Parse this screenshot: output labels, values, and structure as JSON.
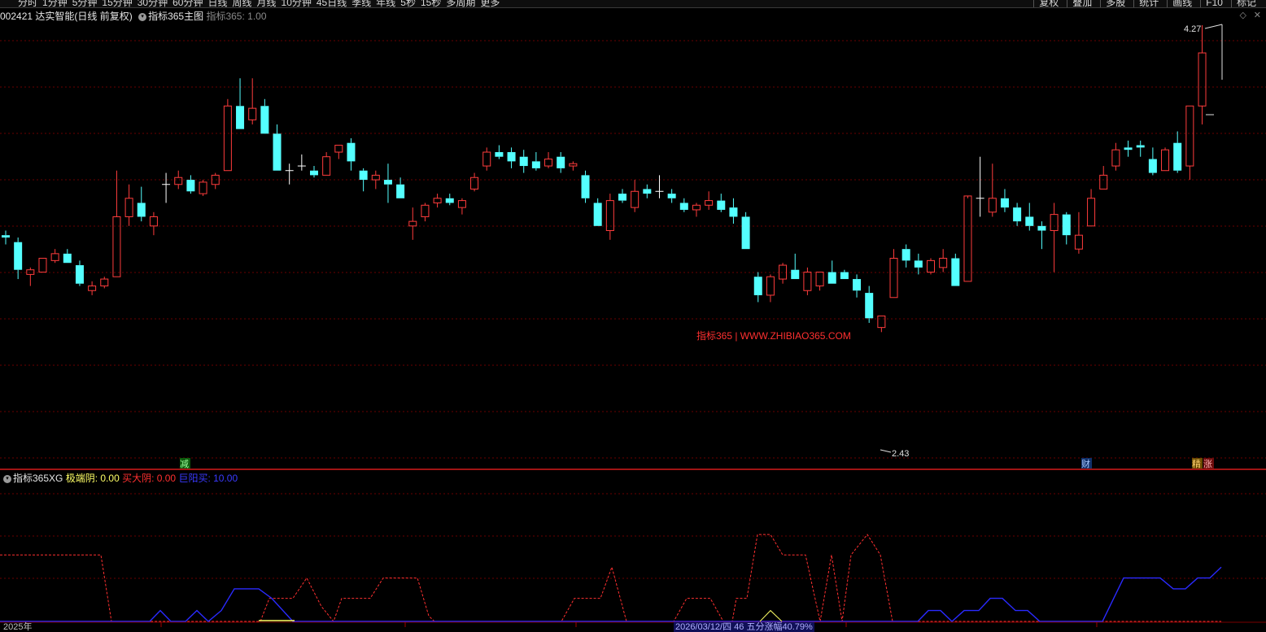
{
  "toolbar": {
    "periods": [
      "分时",
      "1分钟",
      "5分钟",
      "15分钟",
      "30分钟",
      "60分钟",
      "日线",
      "周线",
      "月线",
      "10分钟",
      "45日线",
      "季线",
      "年线",
      "5秒",
      "15秒",
      "多周期",
      "更多"
    ],
    "right_items": [
      "复权",
      "叠加",
      "多股",
      "统计",
      "画线",
      "F10",
      "标记"
    ]
  },
  "stock_header": {
    "code": "002421",
    "name": "达实智能",
    "mode": "(日线 前复权)",
    "indicator_name": "指标365主图",
    "indicator_value_label": "指标365: 1.00"
  },
  "indicator_header": {
    "name": "指标365XG",
    "items": [
      {
        "label": "极端阴: 0.00",
        "color": "#ffff66"
      },
      {
        "label": "买大阴: 0.00",
        "color": "#ff3030"
      },
      {
        "label": "巨阳买: 10.00",
        "color": "#3a3aff"
      }
    ]
  },
  "watermark": "指标365 | WWW.ZHIBIAO365.COM",
  "markers": {
    "high_price": "4.27",
    "low_price": "2.43",
    "event_left": "减",
    "event_cai": "财",
    "event_jing": "精",
    "event_zhang": "涨"
  },
  "bottom": {
    "year": "2025年",
    "date_info": "2026/03/12/四 46 五分涨幅40.79%"
  },
  "colors": {
    "up": "#ff3c3c",
    "down": "#54ffff",
    "doji": "#ffffff",
    "grid": "#6a0000",
    "divider": "#ff2020",
    "line_red": "#ff3030",
    "line_blue": "#2a2aff",
    "line_yellow": "#ffff66"
  },
  "chart_data": {
    "type": "candlestick",
    "price_range": [
      2.43,
      4.27
    ],
    "candles": [
      [
        3.36,
        3.38,
        3.32,
        3.35
      ],
      [
        3.33,
        3.35,
        3.17,
        3.21
      ],
      [
        3.19,
        3.22,
        3.14,
        3.21
      ],
      [
        3.2,
        3.26,
        3.2,
        3.26
      ],
      [
        3.25,
        3.3,
        3.24,
        3.28
      ],
      [
        3.28,
        3.3,
        3.24,
        3.24
      ],
      [
        3.23,
        3.25,
        3.14,
        3.15
      ],
      [
        3.12,
        3.16,
        3.1,
        3.14
      ],
      [
        3.14,
        3.18,
        3.13,
        3.17
      ],
      [
        3.18,
        3.64,
        3.18,
        3.44
      ],
      [
        3.44,
        3.58,
        3.4,
        3.52
      ],
      [
        3.5,
        3.57,
        3.42,
        3.44
      ],
      [
        3.4,
        3.46,
        3.36,
        3.44
      ],
      [
        3.58,
        3.63,
        3.5,
        3.58
      ],
      [
        3.58,
        3.64,
        3.56,
        3.61
      ],
      [
        3.6,
        3.62,
        3.54,
        3.55
      ],
      [
        3.54,
        3.6,
        3.53,
        3.59
      ],
      [
        3.58,
        3.63,
        3.56,
        3.62
      ],
      [
        3.64,
        3.95,
        3.64,
        3.92
      ],
      [
        3.92,
        4.04,
        3.82,
        3.82
      ],
      [
        3.86,
        4.04,
        3.84,
        3.91
      ],
      [
        3.92,
        3.95,
        3.8,
        3.8
      ],
      [
        3.8,
        3.84,
        3.64,
        3.64
      ],
      [
        3.64,
        3.67,
        3.58,
        3.64
      ],
      [
        3.66,
        3.71,
        3.64,
        3.66
      ],
      [
        3.64,
        3.66,
        3.61,
        3.62
      ],
      [
        3.62,
        3.72,
        3.62,
        3.7
      ],
      [
        3.72,
        3.75,
        3.69,
        3.75
      ],
      [
        3.76,
        3.78,
        3.64,
        3.68
      ],
      [
        3.64,
        3.65,
        3.55,
        3.6
      ],
      [
        3.6,
        3.64,
        3.56,
        3.62
      ],
      [
        3.6,
        3.67,
        3.5,
        3.58
      ],
      [
        3.58,
        3.61,
        3.52,
        3.52
      ],
      [
        3.4,
        3.48,
        3.34,
        3.42
      ],
      [
        3.44,
        3.5,
        3.42,
        3.49
      ],
      [
        3.5,
        3.54,
        3.48,
        3.52
      ],
      [
        3.52,
        3.54,
        3.49,
        3.5
      ],
      [
        3.48,
        3.52,
        3.45,
        3.51
      ],
      [
        3.56,
        3.63,
        3.55,
        3.61
      ],
      [
        3.66,
        3.74,
        3.64,
        3.72
      ],
      [
        3.72,
        3.75,
        3.69,
        3.7
      ],
      [
        3.72,
        3.74,
        3.65,
        3.68
      ],
      [
        3.7,
        3.73,
        3.63,
        3.66
      ],
      [
        3.68,
        3.72,
        3.64,
        3.65
      ],
      [
        3.66,
        3.72,
        3.65,
        3.69
      ],
      [
        3.7,
        3.72,
        3.63,
        3.65
      ],
      [
        3.66,
        3.68,
        3.64,
        3.67
      ],
      [
        3.62,
        3.64,
        3.5,
        3.52
      ],
      [
        3.5,
        3.52,
        3.4,
        3.4
      ],
      [
        3.38,
        3.54,
        3.34,
        3.51
      ],
      [
        3.54,
        3.56,
        3.5,
        3.51
      ],
      [
        3.48,
        3.6,
        3.46,
        3.55
      ],
      [
        3.56,
        3.58,
        3.52,
        3.54
      ],
      [
        3.55,
        3.62,
        3.52,
        3.55
      ],
      [
        3.54,
        3.56,
        3.5,
        3.52
      ],
      [
        3.5,
        3.52,
        3.46,
        3.47
      ],
      [
        3.47,
        3.5,
        3.44,
        3.49
      ],
      [
        3.49,
        3.55,
        3.47,
        3.51
      ],
      [
        3.51,
        3.54,
        3.46,
        3.47
      ],
      [
        3.48,
        3.52,
        3.41,
        3.44
      ],
      [
        3.44,
        3.46,
        3.3,
        3.3
      ],
      [
        3.18,
        3.2,
        3.07,
        3.1
      ],
      [
        3.1,
        3.19,
        3.07,
        3.18
      ],
      [
        3.17,
        3.24,
        3.15,
        3.23
      ],
      [
        3.21,
        3.28,
        3.17,
        3.17
      ],
      [
        3.12,
        3.22,
        3.1,
        3.2
      ],
      [
        3.14,
        3.2,
        3.12,
        3.2
      ],
      [
        3.2,
        3.25,
        3.15,
        3.15
      ],
      [
        3.2,
        3.21,
        3.17,
        3.17
      ],
      [
        3.17,
        3.19,
        3.09,
        3.12
      ],
      [
        3.11,
        3.14,
        2.98,
        3.0
      ],
      [
        2.96,
        3.01,
        2.94,
        3.01
      ],
      [
        3.09,
        3.3,
        3.09,
        3.26
      ],
      [
        3.3,
        3.32,
        3.22,
        3.25
      ],
      [
        3.25,
        3.28,
        3.19,
        3.22
      ],
      [
        3.2,
        3.26,
        3.19,
        3.25
      ],
      [
        3.22,
        3.3,
        3.2,
        3.26
      ],
      [
        3.26,
        3.28,
        3.14,
        3.14
      ],
      [
        3.16,
        3.52,
        3.16,
        3.53
      ],
      [
        3.52,
        3.7,
        3.44,
        3.52
      ],
      [
        3.46,
        3.67,
        3.44,
        3.52
      ],
      [
        3.52,
        3.56,
        3.46,
        3.48
      ],
      [
        3.48,
        3.5,
        3.4,
        3.42
      ],
      [
        3.44,
        3.5,
        3.38,
        3.4
      ],
      [
        3.4,
        3.42,
        3.3,
        3.38
      ],
      [
        3.38,
        3.5,
        3.2,
        3.45
      ],
      [
        3.45,
        3.46,
        3.32,
        3.36
      ],
      [
        3.3,
        3.46,
        3.28,
        3.36
      ],
      [
        3.4,
        3.56,
        3.4,
        3.52
      ],
      [
        3.56,
        3.66,
        3.56,
        3.62
      ],
      [
        3.66,
        3.76,
        3.64,
        3.73
      ],
      [
        3.74,
        3.77,
        3.7,
        3.73
      ],
      [
        3.75,
        3.77,
        3.7,
        3.74
      ],
      [
        3.69,
        3.74,
        3.62,
        3.63
      ],
      [
        3.64,
        3.74,
        3.64,
        3.73
      ],
      [
        3.76,
        3.81,
        3.63,
        3.64
      ],
      [
        3.66,
        3.92,
        3.6,
        3.92
      ],
      [
        3.92,
        4.27,
        3.84,
        4.15
      ]
    ]
  },
  "indicator_data": {
    "type": "line",
    "ylim": [
      0,
      10
    ],
    "series": [
      {
        "name": "买大阴",
        "style": "dashed",
        "points": [
          [
            0,
            4.9
          ],
          [
            124,
            4.9
          ],
          [
            137,
            0
          ],
          [
            320,
            0
          ],
          [
            331,
            1.7
          ],
          [
            360,
            1.7
          ],
          [
            377,
            3.2
          ],
          [
            395,
            1.1
          ],
          [
            410,
            0
          ],
          [
            420,
            1.7
          ],
          [
            455,
            1.7
          ],
          [
            471,
            3.2
          ],
          [
            513,
            3.2
          ],
          [
            527,
            0.4
          ],
          [
            534,
            0
          ],
          [
            690,
            0
          ],
          [
            706,
            1.7
          ],
          [
            738,
            1.7
          ],
          [
            752,
            4.0
          ],
          [
            770,
            0
          ],
          [
            828,
            0
          ],
          [
            844,
            1.7
          ],
          [
            873,
            1.7
          ],
          [
            889,
            0
          ],
          [
            900,
            0
          ],
          [
            905,
            1.7
          ],
          [
            918,
            1.7
          ],
          [
            931,
            6.4
          ],
          [
            947,
            6.4
          ],
          [
            962,
            4.9
          ],
          [
            990,
            4.9
          ],
          [
            1008,
            0
          ],
          [
            1022,
            4.9
          ],
          [
            1035,
            0
          ],
          [
            1046,
            4.9
          ],
          [
            1066,
            6.4
          ],
          [
            1082,
            4.9
          ],
          [
            1097,
            0
          ],
          [
            1501,
            0
          ]
        ]
      },
      {
        "name": "巨阳买",
        "style": "solid",
        "points": [
          [
            0,
            0
          ],
          [
            184,
            0
          ],
          [
            197,
            0.8
          ],
          [
            210,
            0
          ],
          [
            228,
            0
          ],
          [
            242,
            0.8
          ],
          [
            256,
            0
          ],
          [
            272,
            0.8
          ],
          [
            288,
            2.4
          ],
          [
            318,
            2.4
          ],
          [
            334,
            1.7
          ],
          [
            360,
            0
          ],
          [
            1128,
            0
          ],
          [
            1141,
            0.8
          ],
          [
            1156,
            0.8
          ],
          [
            1170,
            0
          ],
          [
            1185,
            0.8
          ],
          [
            1203,
            0.8
          ],
          [
            1217,
            1.7
          ],
          [
            1232,
            1.7
          ],
          [
            1248,
            0.8
          ],
          [
            1263,
            0.8
          ],
          [
            1278,
            0
          ],
          [
            1355,
            0
          ],
          [
            1381,
            3.2
          ],
          [
            1426,
            3.2
          ],
          [
            1442,
            2.4
          ],
          [
            1457,
            2.4
          ],
          [
            1472,
            3.2
          ],
          [
            1487,
            3.2
          ],
          [
            1501,
            4.0
          ]
        ]
      },
      {
        "name": "极端阴",
        "style": "solid",
        "points": [
          [
            934,
            0
          ],
          [
            947,
            0.8
          ],
          [
            961,
            0
          ]
        ]
      }
    ]
  }
}
